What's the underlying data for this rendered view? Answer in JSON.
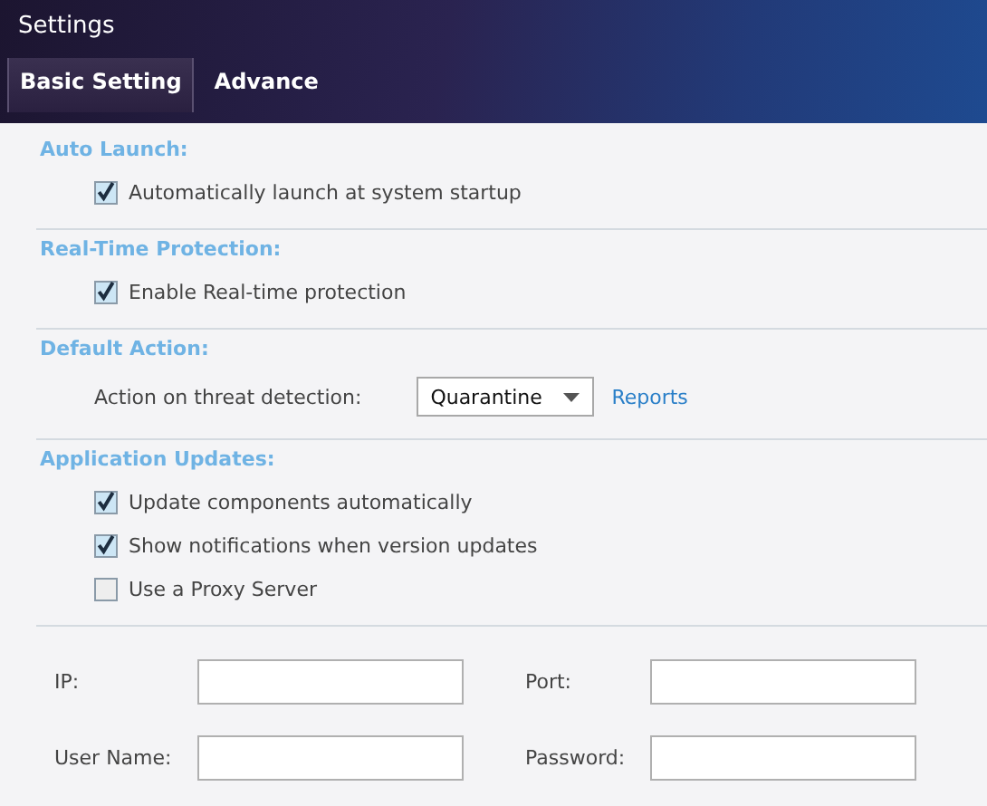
{
  "window": {
    "title": "Settings"
  },
  "tabs": [
    {
      "label": "Basic Setting",
      "selected": true
    },
    {
      "label": "Advance",
      "selected": false
    }
  ],
  "sections": [
    {
      "heading": "Auto Launch:",
      "items": [
        {
          "kind": "checkbox",
          "label": "Automatically launch at system startup",
          "checked": true
        }
      ]
    },
    {
      "heading": "Real-Time Protection:",
      "items": [
        {
          "kind": "checkbox",
          "label": "Enable Real-time protection",
          "checked": true
        }
      ]
    },
    {
      "heading": "Default Action:",
      "items": [
        {
          "kind": "select",
          "label": "Action on threat detection:",
          "value": "Quarantine",
          "link": "Reports"
        }
      ]
    },
    {
      "heading": "Application Updates:",
      "items": [
        {
          "kind": "checkbox",
          "label": "Update components automatically",
          "checked": true
        },
        {
          "kind": "checkbox",
          "label": "Show notifications when version updates",
          "checked": true
        },
        {
          "kind": "checkbox",
          "label": "Use a Proxy Server",
          "checked": false
        }
      ]
    }
  ],
  "proxy_fields": [
    {
      "label": "IP:"
    },
    {
      "label": "Port:"
    },
    {
      "label": "User Name:"
    },
    {
      "label": "Password:"
    }
  ]
}
